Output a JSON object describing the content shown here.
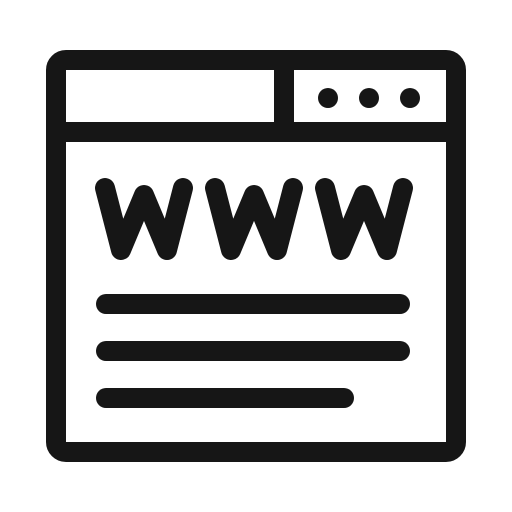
{
  "icon": {
    "name": "web-browser-www-icon",
    "lettering": "www",
    "color": "#161616",
    "background": "#ffffff"
  }
}
